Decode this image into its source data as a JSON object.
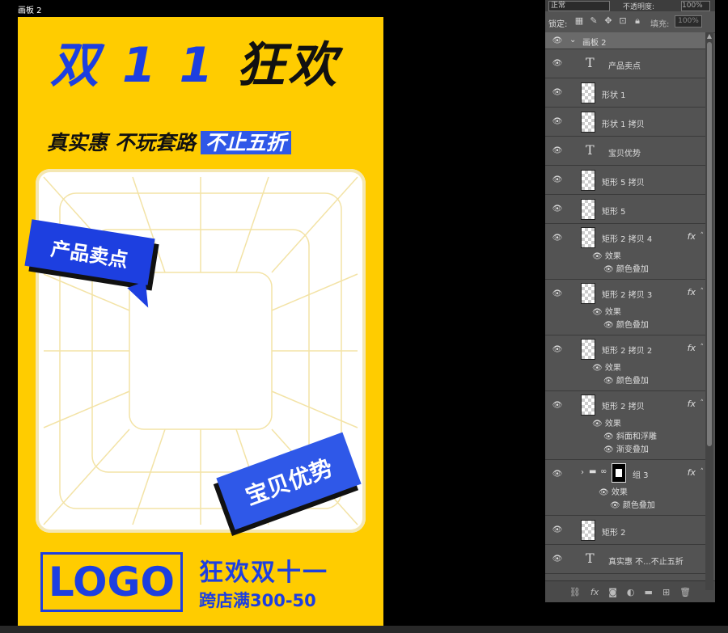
{
  "artboard": {
    "title": "画板 2",
    "headline": {
      "part1": "双 1 1 ",
      "part2": "狂欢"
    },
    "subline": {
      "text": "真实惠 不玩套路",
      "highlight": "不止五折"
    },
    "tag_selling_point": "产品卖点",
    "tag_advantage": "宝贝优势",
    "logo": "LOGO",
    "promo_line1": "狂欢双十一",
    "promo_line2": "跨店满300-50",
    "colors": {
      "background": "#ffcc00",
      "blue": "#1d3fe0",
      "dark": "#111111",
      "frame": "#ffffff"
    }
  },
  "layers_panel": {
    "blend_mode": "正常",
    "opacity_label": "不透明度:",
    "opacity_value": "100%",
    "lock_label": "锁定:",
    "fill_label": "填充:",
    "fill_value": "100%",
    "layers": [
      {
        "name": "画板 2",
        "type": "artboard"
      },
      {
        "name": "产品卖点",
        "type": "text"
      },
      {
        "name": "形状 1",
        "type": "shape"
      },
      {
        "name": "形状 1 拷贝",
        "type": "shape"
      },
      {
        "name": "宝贝优势",
        "type": "text"
      },
      {
        "name": "矩形 5 拷贝",
        "type": "shape"
      },
      {
        "name": "矩形 5",
        "type": "shape"
      },
      {
        "name": "矩形 2 拷贝 4",
        "type": "shape",
        "effects": [
          "颜色叠加"
        ]
      },
      {
        "name": "矩形 2 拷贝 3",
        "type": "shape",
        "effects": [
          "颜色叠加"
        ]
      },
      {
        "name": "矩形 2 拷贝 2",
        "type": "shape",
        "effects": [
          "颜色叠加"
        ]
      },
      {
        "name": "矩形 2 拷贝",
        "type": "shape",
        "effects": [
          "斜面和浮雕",
          "渐变叠加"
        ]
      },
      {
        "name": "组 3",
        "type": "group",
        "effects": [
          "颜色叠加"
        ]
      },
      {
        "name": "矩形 2",
        "type": "shape"
      },
      {
        "name": "真实惠 不...不止五折",
        "type": "text"
      }
    ],
    "effects_label": "效果",
    "fx_label": "fx",
    "toolbar_icons": [
      "link-icon",
      "fx-icon",
      "mask-icon",
      "adjustment-icon",
      "folder-icon",
      "new-layer-icon",
      "trash-icon"
    ]
  }
}
